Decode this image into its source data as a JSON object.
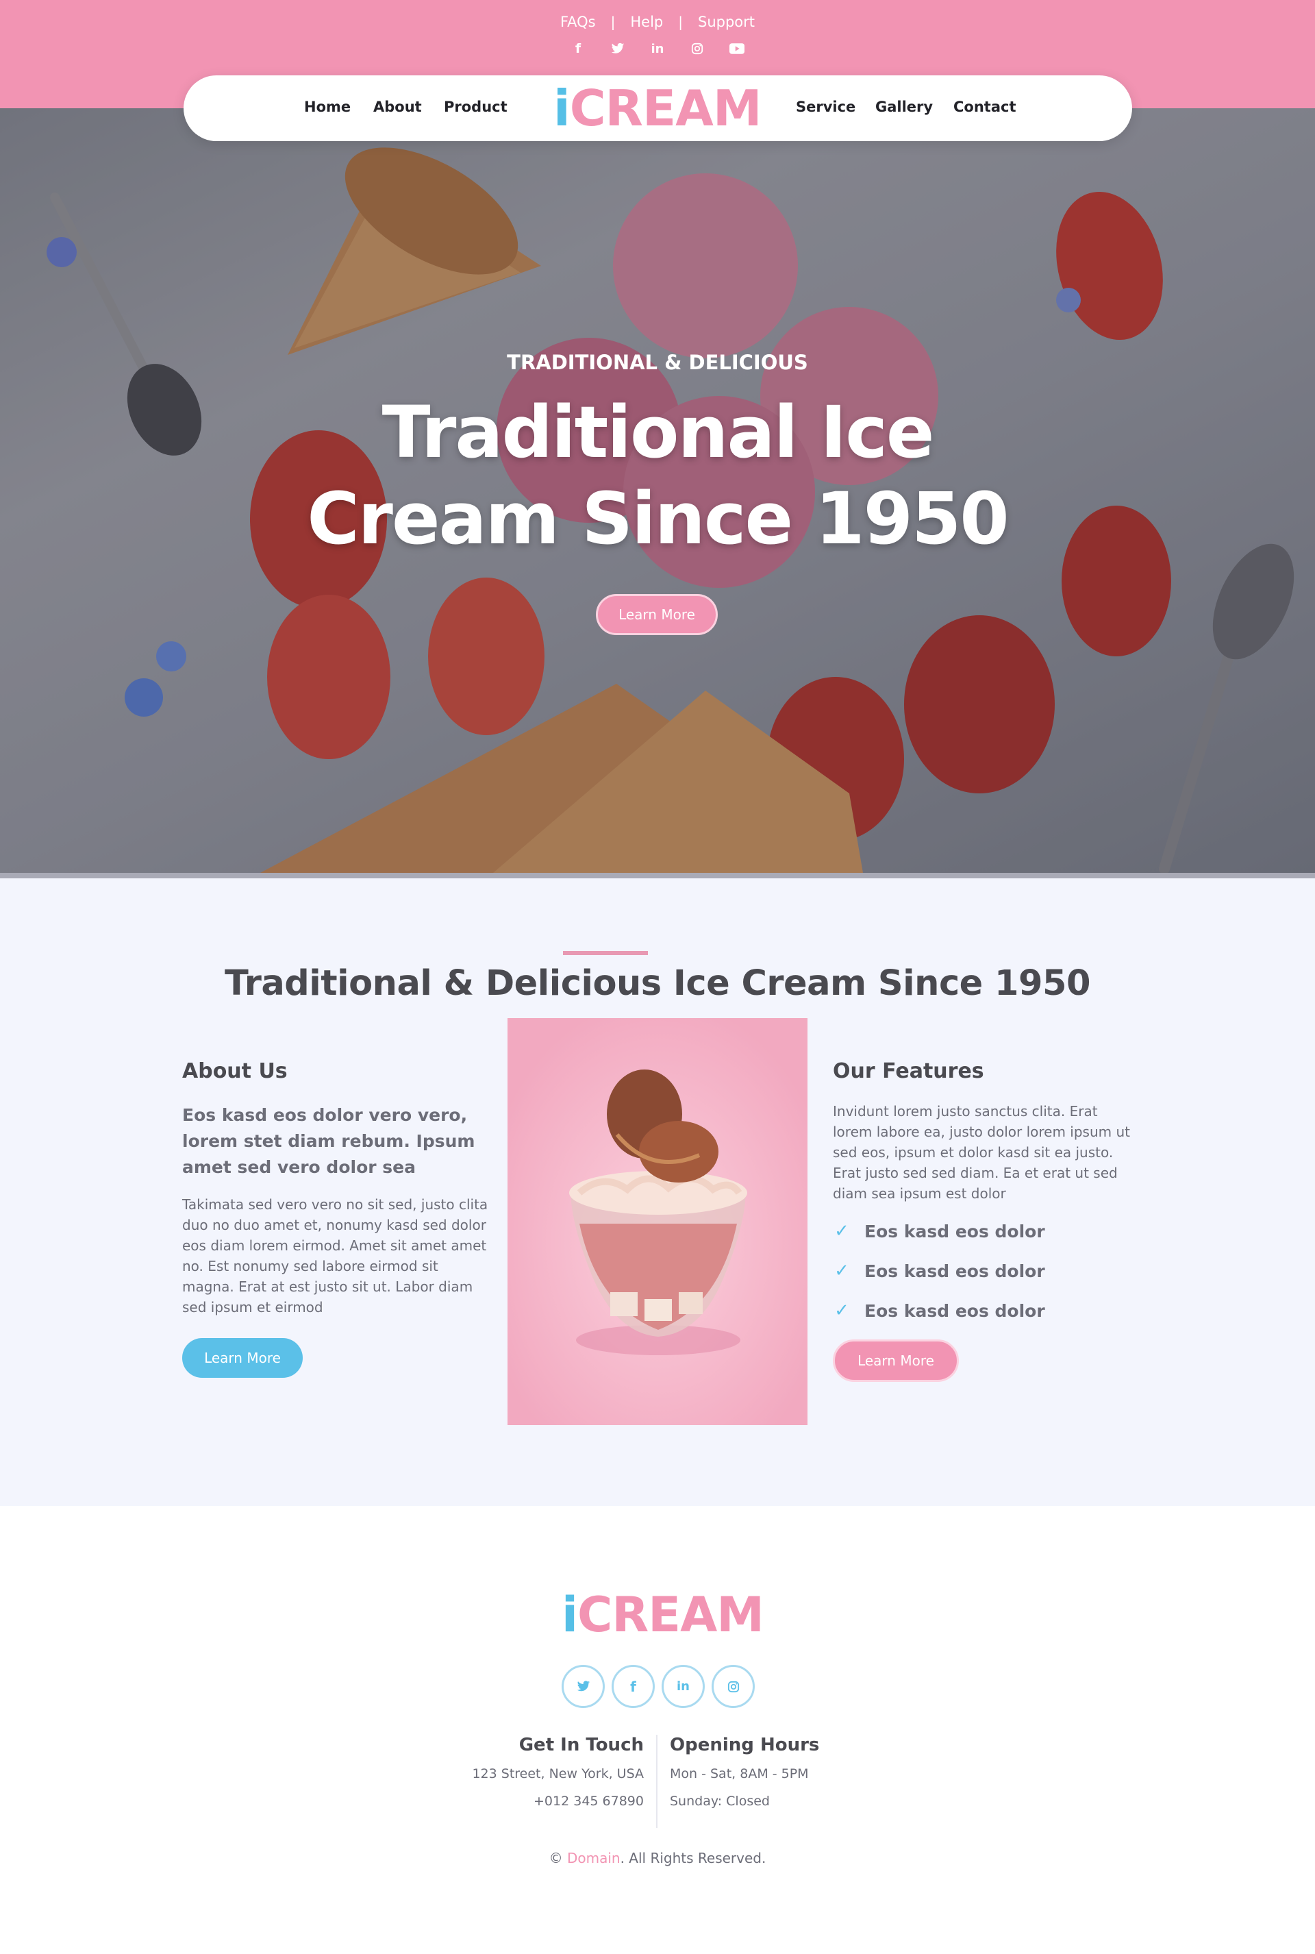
{
  "topbar": {
    "links": [
      "FAQs",
      "Help",
      "Support"
    ],
    "separator": "|",
    "social_icons": [
      "facebook-icon",
      "twitter-icon",
      "linkedin-icon",
      "instagram-icon",
      "youtube-icon"
    ]
  },
  "nav": {
    "left_items": [
      "Home",
      "About",
      "Product"
    ],
    "right_items": [
      "Service",
      "Gallery",
      "Contact"
    ],
    "logo_prefix": "i",
    "logo_main": "CREAM"
  },
  "hero": {
    "subtitle": "TRADITIONAL & DELICIOUS",
    "title_line1": "Traditional Ice",
    "title_line2": "Cream Since 1950",
    "button": "Learn More"
  },
  "about": {
    "heading": "Traditional & Delicious Ice Cream Since 1950",
    "left": {
      "title": "About Us",
      "lead": "Eos kasd eos dolor vero vero, lorem stet diam rebum. Ipsum amet sed vero dolor sea",
      "body": "Takimata sed vero vero no sit sed, justo clita duo no duo amet et, nonumy kasd sed dolor eos diam lorem eirmod. Amet sit amet amet no. Est nonumy sed labore eirmod sit magna. Erat at est justo sit ut. Labor diam sed ipsum et eirmod",
      "button": "Learn More"
    },
    "right": {
      "title": "Our Features",
      "body": "Invidunt lorem justo sanctus clita. Erat lorem labore ea, justo dolor lorem ipsum ut sed eos, ipsum et dolor kasd sit ea justo. Erat justo sed sed diam. Ea et erat ut sed diam sea ipsum est dolor",
      "features": [
        "Eos kasd eos dolor",
        "Eos kasd eos dolor",
        "Eos kasd eos dolor"
      ],
      "button": "Learn More"
    }
  },
  "footer": {
    "logo_prefix": "i",
    "logo_main": "CREAM",
    "social_icons": [
      "twitter-icon",
      "facebook-icon",
      "linkedin-icon",
      "instagram-icon"
    ],
    "contact": {
      "title": "Get In Touch",
      "address": "123 Street, New York, USA",
      "phone": "+012 345 67890"
    },
    "hours": {
      "title": "Opening Hours",
      "weekdays": "Mon - Sat, 8AM - 5PM",
      "sunday": "Sunday: Closed"
    },
    "copyright_prefix": "©",
    "copyright_link": "Domain",
    "copyright_suffix": ". All Rights Reserved."
  },
  "colors": {
    "pink": "#f294b3",
    "blue": "#5bc0e8",
    "section_bg": "#f3f5fd",
    "heading": "#4a4a50"
  }
}
